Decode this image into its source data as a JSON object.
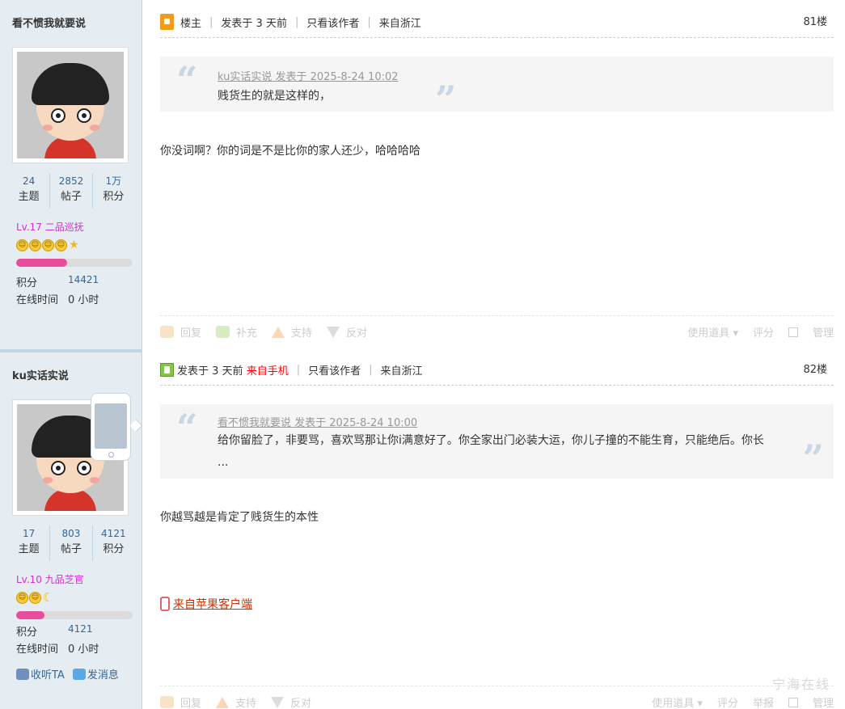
{
  "post1": {
    "username": "看不惯我就要说",
    "stats": [
      {
        "value": "24",
        "label": "主题"
      },
      {
        "value": "2852",
        "label": "帖子"
      },
      {
        "value": "1万",
        "label": "积分"
      }
    ],
    "level": "Lv.17 二品巡抚",
    "level_progress": 0.44,
    "points_label": "积分",
    "points_value": "14421",
    "online_label": "在线时间",
    "online_value": "0 小时",
    "header": {
      "op_label": "楼主",
      "posted": "发表于 3 天前",
      "only_author": "只看该作者",
      "location": "来自浙江",
      "floor": "81楼"
    },
    "quote": {
      "author": "ku实话实说 发表于 2025-8-24 10:02",
      "text": "贱货生的就是这样的，"
    },
    "content": "你没词啊？你的词是不是比你的家人还少，哈哈哈哈",
    "actions": {
      "reply": "回复",
      "supplement": "补充",
      "support": "支持",
      "oppose": "反对",
      "tools": "使用道具",
      "rate": "评分",
      "manage": "管理"
    }
  },
  "post2": {
    "username": "ku实话实说",
    "stats": [
      {
        "value": "17",
        "label": "主题"
      },
      {
        "value": "803",
        "label": "帖子"
      },
      {
        "value": "4121",
        "label": "积分"
      }
    ],
    "level": "Lv.10 九品芝官",
    "level_progress": 0.24,
    "points_label": "积分",
    "points_value": "4121",
    "online_label": "在线时间",
    "online_value": "0 小时",
    "follow": "收听TA",
    "message": "发消息",
    "header": {
      "posted": "发表于 3 天前",
      "mobile": "来自手机",
      "only_author": "只看该作者",
      "location": "来自浙江",
      "floor": "82楼"
    },
    "quote": {
      "author": "看不惯我就要说 发表于 2025-8-24 10:00",
      "text": "给你留脸了，非要骂，喜欢骂那让你i满意好了。你全家出门必装大运，你儿子撞的不能生育，只能绝后。你长 ..."
    },
    "content": "你越骂越是肯定了贱货生的本性",
    "client": "来自苹果客户端",
    "actions": {
      "reply": "回复",
      "support": "支持",
      "oppose": "反对",
      "tools": "使用道具",
      "rate": "评分",
      "report": "举报",
      "manage": "管理"
    }
  },
  "watermark": "宁海在线",
  "colors": {
    "sidebar_bg": "#e5edf2",
    "link_blue": "#336699",
    "level_purple": "#cc33cc",
    "progress_pink": "#e64d9c",
    "mobile_red": "#ff0000",
    "client_link": "#cc3300"
  }
}
